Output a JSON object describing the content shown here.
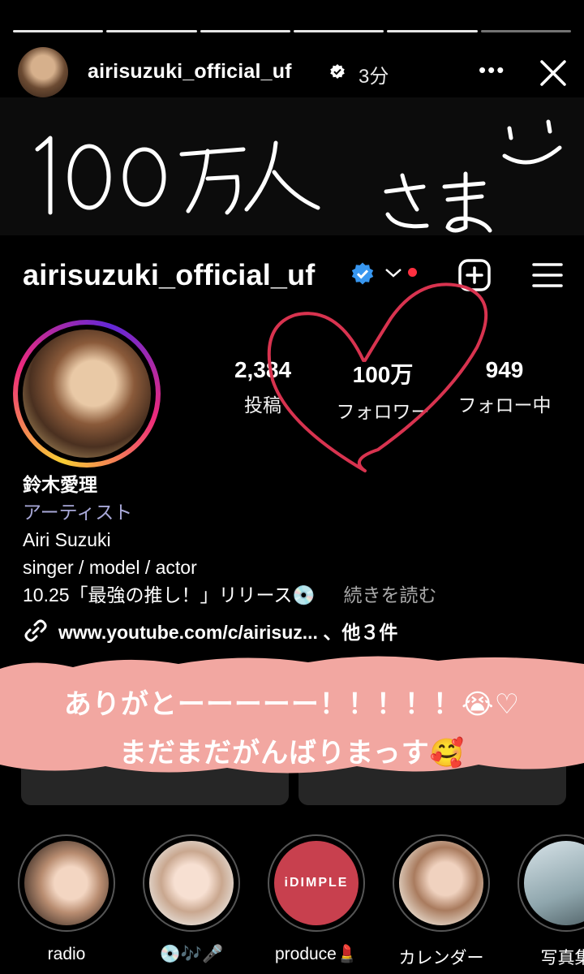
{
  "story": {
    "username": "airisuzuki_official_uf",
    "time": "3分",
    "handwriting": "100万人さま",
    "progress_segments": 6
  },
  "profile": {
    "username": "airisuzuki_official_uf",
    "stats": {
      "posts_value": "2,384",
      "posts_label": "投稿",
      "followers_value": "100万",
      "followers_label": "フォロワー",
      "following_value": "949",
      "following_label": "フォロー中"
    },
    "bio": {
      "name": "鈴木愛理",
      "category": "アーティスト",
      "line1": "Airi Suzuki",
      "line2": "singer / model / actor",
      "line3": "10.25「最強の推し！」リリース💿",
      "more": "続きを読む"
    },
    "link": "www.youtube.com/c/airisuz... 、他３件"
  },
  "overlay": {
    "line1": "ありがとーーーーー！！！！！😭♡",
    "line2": "まだまだがんばりまっす🥰",
    "tape_color": "#f2a7a1"
  },
  "highlights": [
    {
      "label": "radio"
    },
    {
      "label": "💿🎶🎤"
    },
    {
      "label": "produce💄",
      "brand": "iDIMPLE"
    },
    {
      "label": "カレンダー"
    },
    {
      "label": "写真集"
    }
  ],
  "colors": {
    "verified": "#3897f0",
    "notification_dot": "#ff3040",
    "heart_stroke": "#d8334f"
  }
}
